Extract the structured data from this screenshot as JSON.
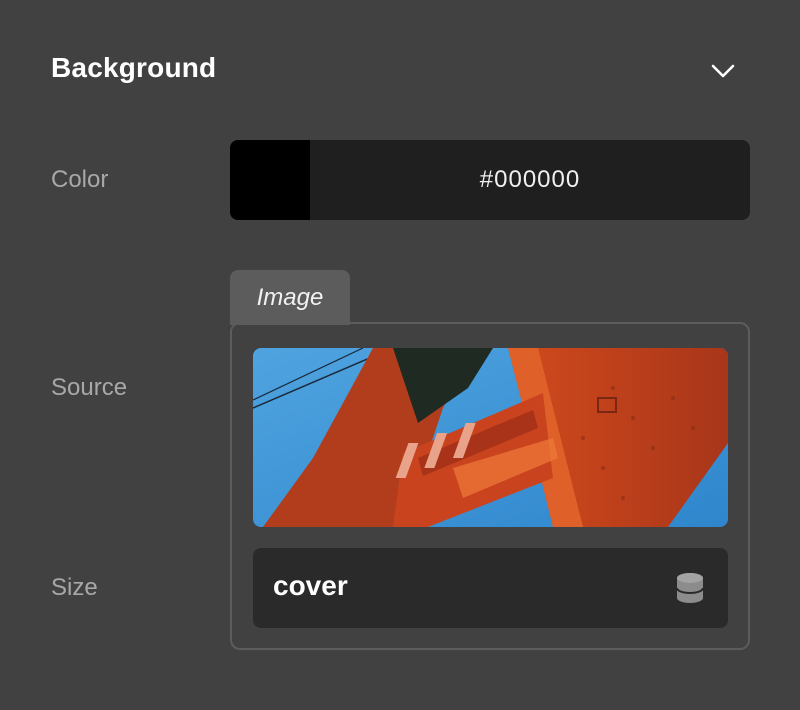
{
  "section": {
    "title": "Background",
    "collapse_icon": "chevron-down-icon"
  },
  "color": {
    "label": "Color",
    "value": "#000000",
    "swatch": "#000000"
  },
  "source": {
    "label": "Source",
    "tab_label": "Image",
    "image_desc": "Golden Gate Bridge tower against blue sky"
  },
  "size": {
    "label": "Size",
    "value": "cover",
    "icon": "database-icon"
  }
}
